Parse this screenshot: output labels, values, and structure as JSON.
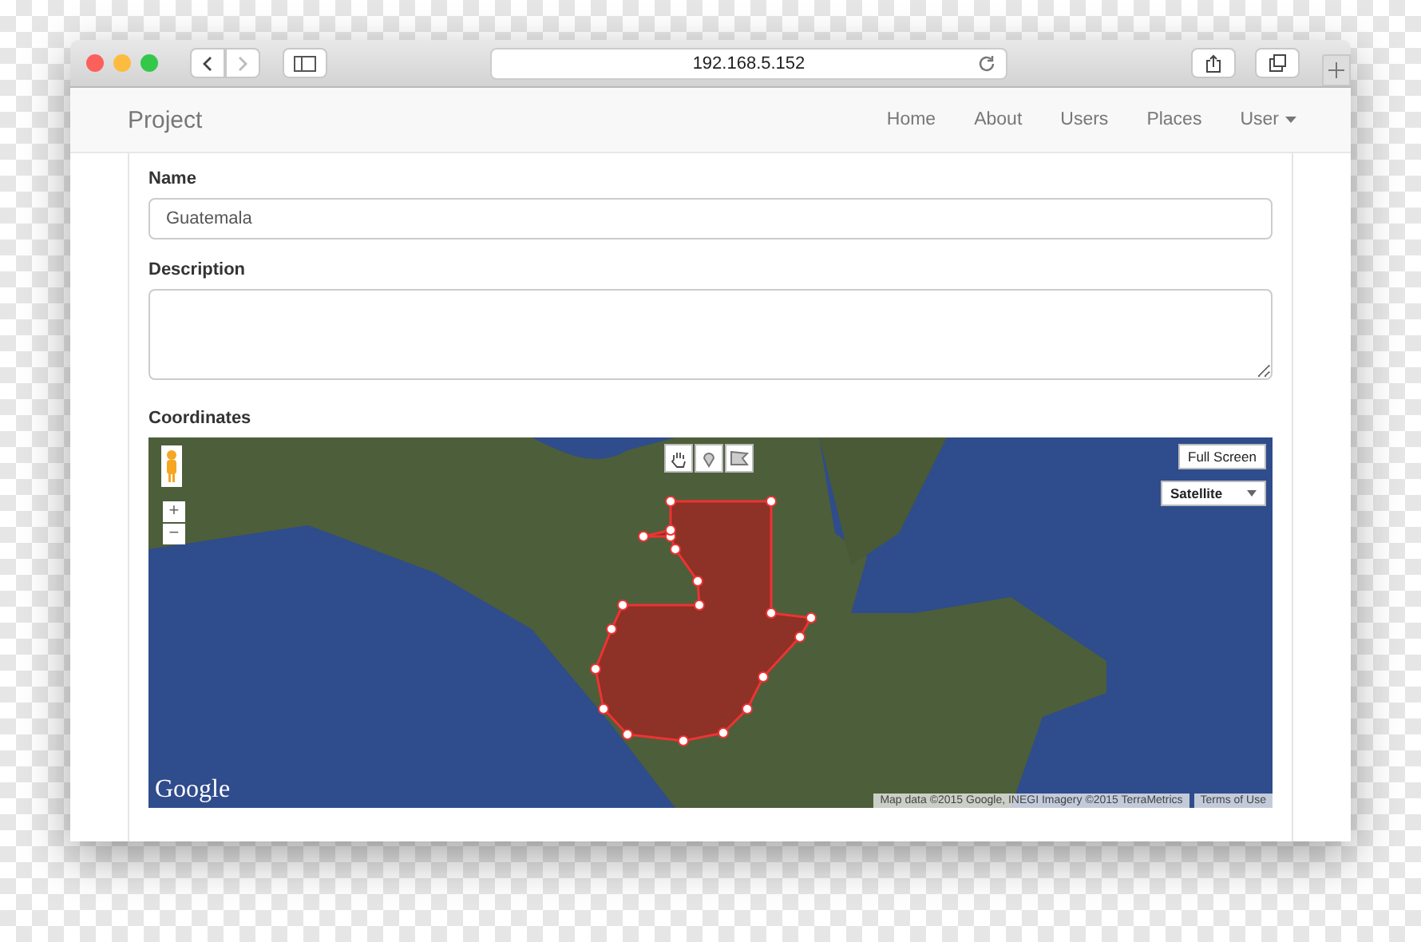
{
  "browser": {
    "address": "192.168.5.152"
  },
  "navbar": {
    "brand": "Project",
    "links": [
      {
        "label": "Home",
        "kind": "link"
      },
      {
        "label": "About",
        "kind": "link"
      },
      {
        "label": "Users",
        "kind": "link"
      },
      {
        "label": "Places",
        "kind": "link"
      },
      {
        "label": "User",
        "kind": "dropdown"
      }
    ]
  },
  "form": {
    "fields": [
      {
        "label": "Name",
        "kind": "input",
        "value": "Guatemala"
      },
      {
        "label": "Description",
        "kind": "textarea"
      }
    ],
    "map_label": "Coordinates"
  },
  "map": {
    "zoom_in": "+",
    "zoom_out": "−",
    "full_screen": "Full Screen",
    "map_type": "Satellite",
    "logo": "Google",
    "attribution": "Map data ©2015 Google, INEGI Imagery ©2015 TerraMetrics",
    "terms": "Terms of Use"
  }
}
